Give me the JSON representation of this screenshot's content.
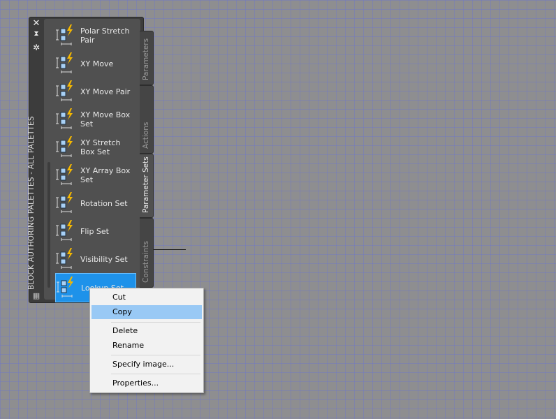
{
  "palette": {
    "title": "BLOCK AUTHORING PALETTES - ALL PALETTES",
    "controls": {
      "close": "close-icon",
      "autohide": "autohide-icon",
      "properties": "gear-icon"
    },
    "items": [
      {
        "label": "Polar Stretch Pair",
        "icon": "polar-stretch-pair-icon"
      },
      {
        "label": "XY Move",
        "icon": "xy-move-icon"
      },
      {
        "label": "XY Move Pair",
        "icon": "xy-move-pair-icon"
      },
      {
        "label": "XY Move Box Set",
        "icon": "xy-move-box-set-icon"
      },
      {
        "label": "XY Stretch Box Set",
        "icon": "xy-stretch-box-set-icon"
      },
      {
        "label": "XY Array Box Set",
        "icon": "xy-array-box-set-icon"
      },
      {
        "label": "Rotation Set",
        "icon": "rotation-set-icon"
      },
      {
        "label": "Flip Set",
        "icon": "flip-set-icon"
      },
      {
        "label": "Visibility Set",
        "icon": "visibility-set-icon"
      },
      {
        "label": "Lookup Set",
        "icon": "lookup-set-icon",
        "selected": true
      }
    ],
    "tabs": [
      {
        "label": "Parameters"
      },
      {
        "label": "Actions"
      },
      {
        "label": "Parameter Sets",
        "active": true
      },
      {
        "label": "Constraints"
      }
    ]
  },
  "context_menu": {
    "items": [
      "Cut",
      "Copy",
      "Delete",
      "Rename",
      "Specify image...",
      "Properties..."
    ],
    "highlighted": "Copy"
  },
  "colors": {
    "selection": "#1e92ea",
    "menu_highlight": "#99c9f5",
    "lightning": "#f5b800"
  }
}
